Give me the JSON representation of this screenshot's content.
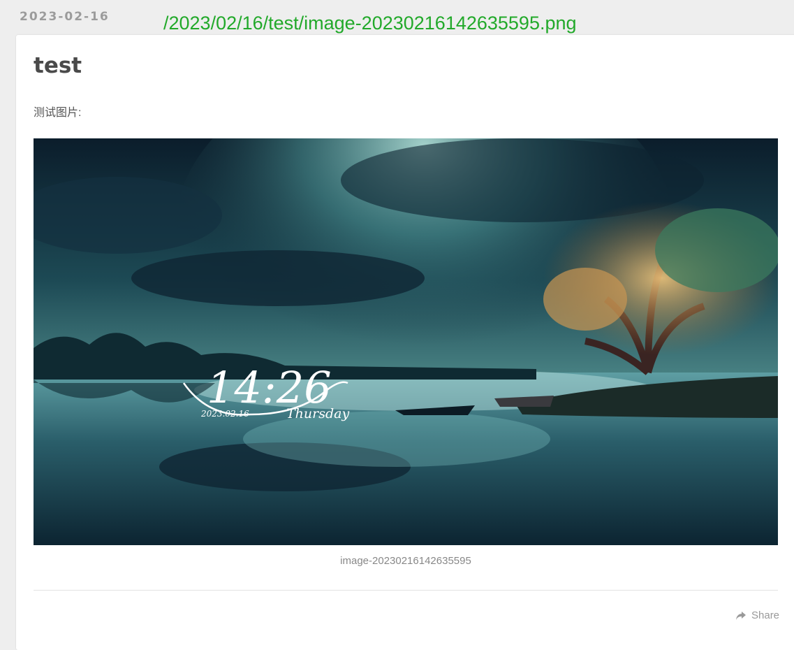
{
  "post": {
    "date": "2023-02-16",
    "title": "test",
    "text": "测试图片:",
    "image_caption": "image-20230216142635595",
    "share_label": "Share"
  },
  "annotation": {
    "path_text": "/2023/02/16/test/image-20230216142635595.png",
    "color": "#22a92a"
  },
  "image_overlay": {
    "time": "14:26",
    "date": "2023.02.16",
    "weekday": "Thursday"
  },
  "colors": {
    "background": "#eeeeee",
    "card": "#ffffff",
    "title": "#4a4a4a",
    "muted": "#999999"
  }
}
